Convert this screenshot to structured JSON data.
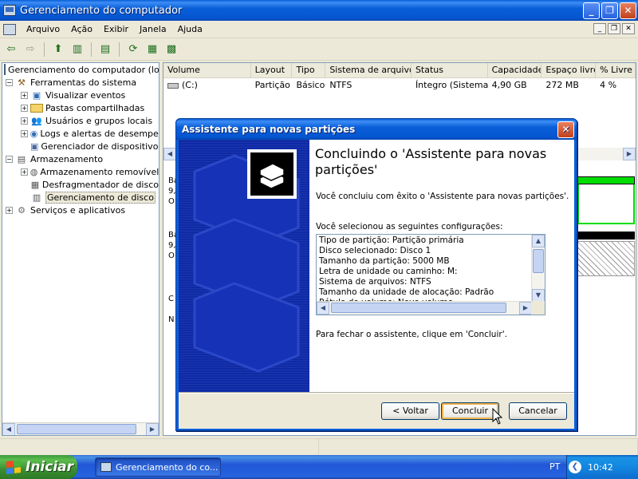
{
  "window": {
    "title": "Gerenciamento do computador"
  },
  "menu": [
    "Arquivo",
    "Ação",
    "Exibir",
    "Janela",
    "Ajuda"
  ],
  "tree": {
    "root": "Gerenciamento do computador (local",
    "items": [
      "Ferramentas do sistema",
      "Visualizar eventos",
      "Pastas compartilhadas",
      "Usuários e grupos locais",
      "Logs e alertas de desempenh",
      "Gerenciador de dispositivos",
      "Armazenamento",
      "Armazenamento removível",
      "Desfragmentador de disco",
      "Gerenciamento de disco",
      "Serviços e aplicativos"
    ]
  },
  "list": {
    "columns": [
      "Volume",
      "Layout",
      "Tipo",
      "Sistema de arquivos",
      "Status",
      "Capacidade",
      "Espaço livre",
      "% Livre"
    ],
    "rows": [
      [
        "(C:)",
        "Partição",
        "Básico",
        "NTFS",
        "Íntegro (Sistema)",
        "4,90 GB",
        "272 MB",
        "4 %"
      ]
    ]
  },
  "disk_fragments": [
    "Ba",
    "9,",
    "O",
    "Ba",
    "9,",
    "O",
    "C",
    "N"
  ],
  "dialog": {
    "title": "Assistente para novas partições",
    "heading": "Concluindo o 'Assistente para novas partições'",
    "line1": "Você concluiu  com êxito o 'Assistente para novas partições'.",
    "line2": "Você selecionou as seguintes configurações:",
    "settings": [
      "Tipo de partição: Partição primária",
      "Disco selecionado: Disco 1",
      "Tamanho da partição: 5000 MB",
      "Letra de unidade ou caminho: M:",
      "Sistema de arquivos: NTFS",
      "Tamanho da unidade de alocação: Padrão",
      "Rótulo do volume: Novo volume"
    ],
    "line3": "Para fechar o assistente, clique em 'Concluir'.",
    "buttons": {
      "back": "< Voltar",
      "finish": "Concluir",
      "cancel": "Cancelar"
    }
  },
  "taskbar": {
    "start": "Iniciar",
    "task": "Gerenciamento do co...",
    "lang": "PT",
    "clock": "10:42"
  },
  "colors": {
    "titlebar": "#0a5fd8",
    "wizard_side": "#0e2aa6",
    "taskbar": "#2157d7",
    "start": "#3a8e32"
  }
}
